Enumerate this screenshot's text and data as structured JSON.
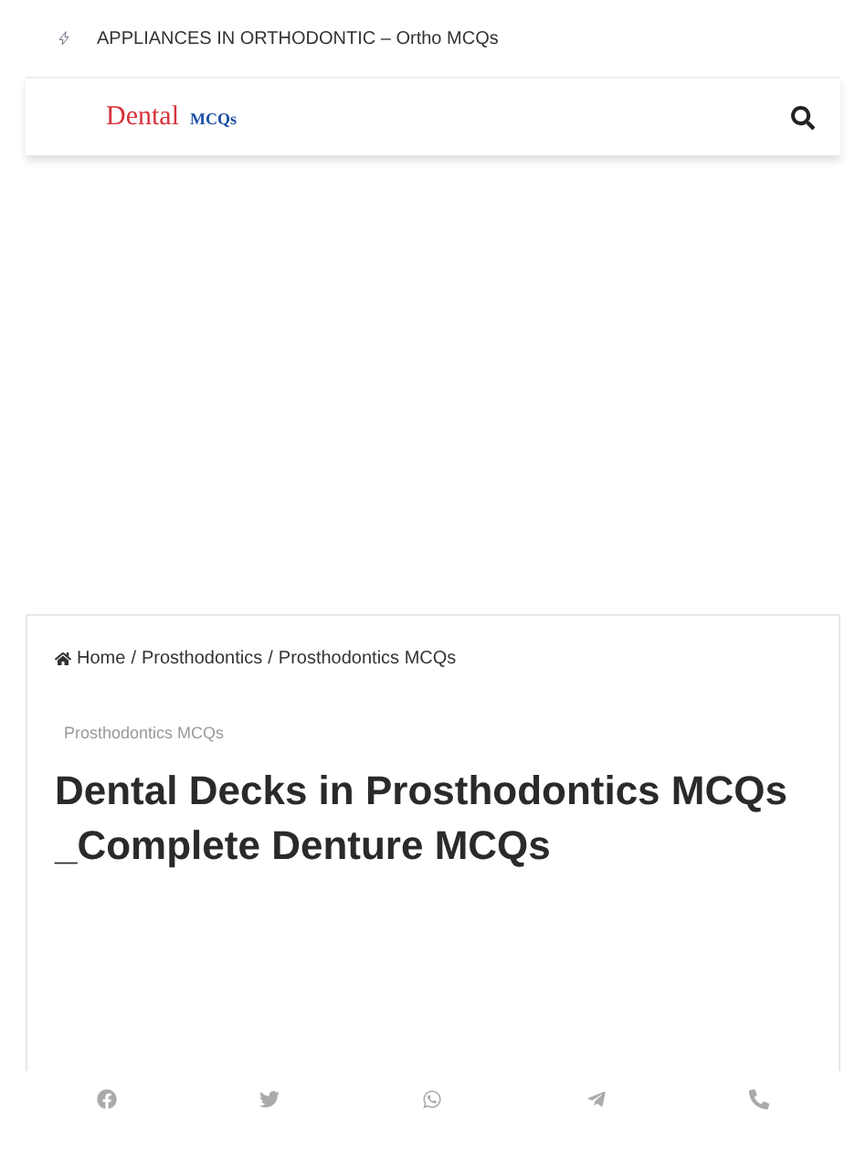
{
  "breaking_news": {
    "headline": "APPLIANCES IN ORTHODONTIC – Ortho MCQs"
  },
  "header": {
    "logo_main": "Dental",
    "logo_sub": "MCQs"
  },
  "breadcrumb": [
    "Home",
    "Prosthodontics",
    "Prosthodontics MCQs"
  ],
  "breadcrumb_separator": "/",
  "post": {
    "category": "Prosthodontics MCQs",
    "title": "Dental Decks in Prosthodontics MCQs _Complete Denture MCQs"
  },
  "share_bar": [
    {
      "kind": "facebook"
    },
    {
      "kind": "twitter"
    },
    {
      "kind": "whatsapp"
    },
    {
      "kind": "telegram"
    },
    {
      "kind": "phone"
    }
  ]
}
